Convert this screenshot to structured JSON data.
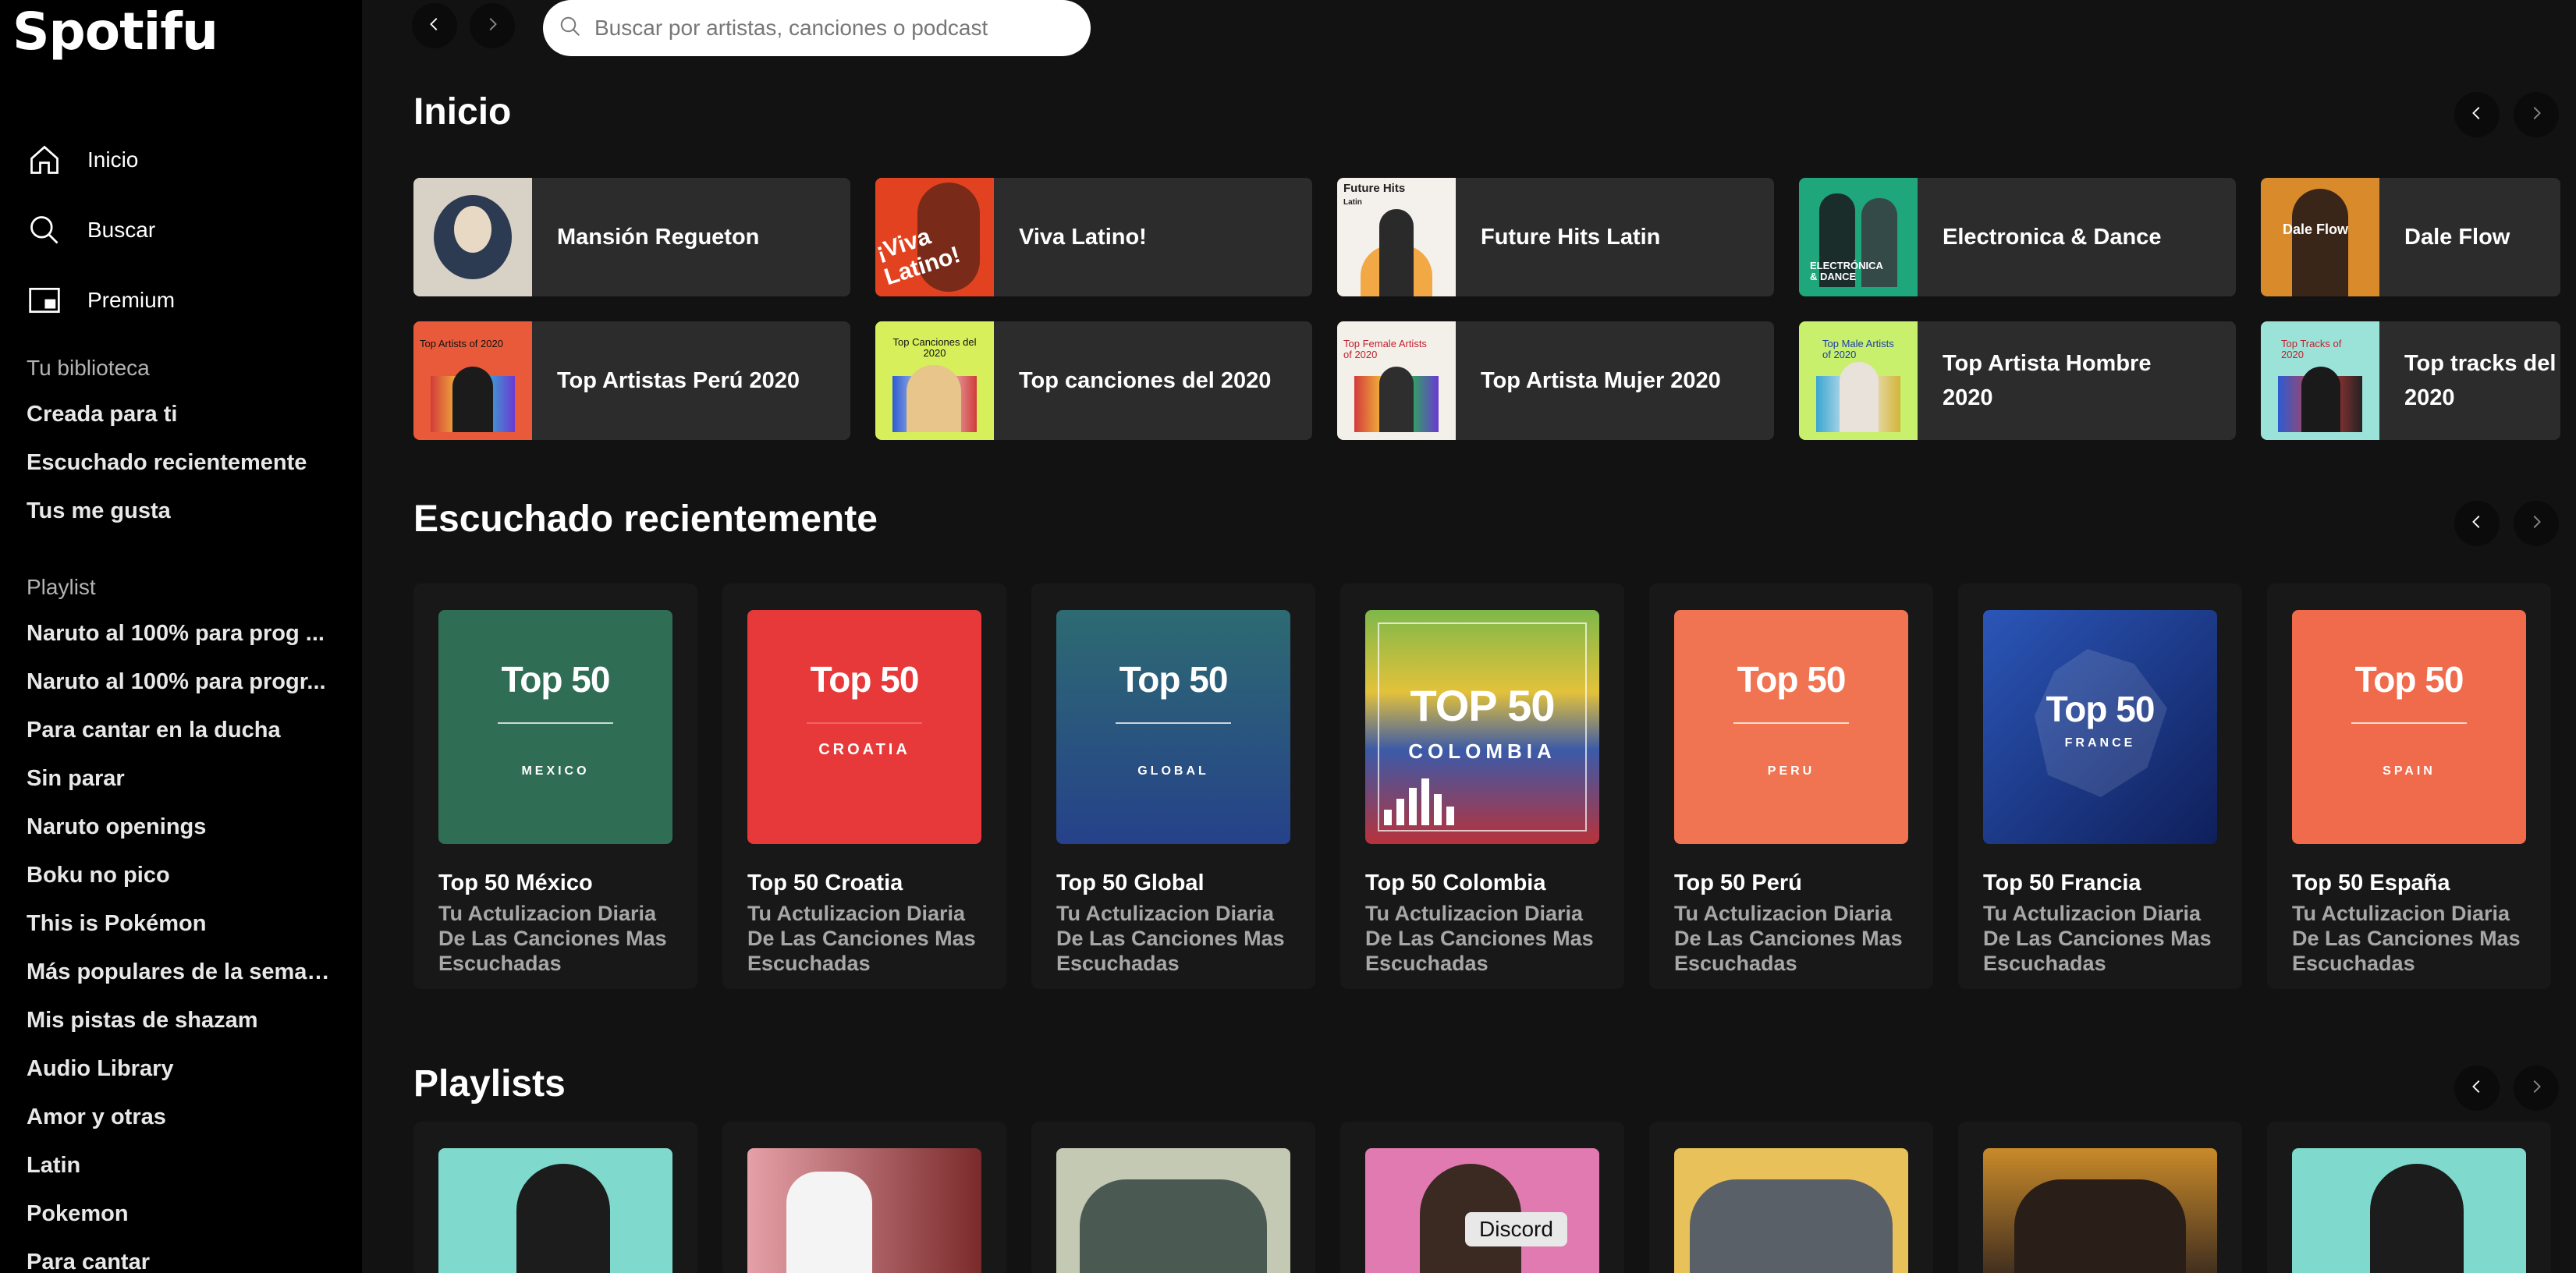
{
  "app": {
    "logo": "Spotifu"
  },
  "sidebar": {
    "nav": [
      {
        "label": "Inicio",
        "icon": "home-icon"
      },
      {
        "label": "Buscar",
        "icon": "search-icon"
      },
      {
        "label": "Premium",
        "icon": "premium-icon"
      }
    ],
    "library_title": "Tu biblioteca",
    "library": [
      "Creada para ti",
      "Escuchado recientemente",
      "Tus me gusta"
    ],
    "playlist_title": "Playlist",
    "playlists": [
      "Naruto al 100% para prog ...",
      "Naruto al 100% para progr...",
      "Para cantar en la ducha",
      "Sin parar",
      "Naruto openings",
      "Boku no pico",
      "This is Pokémon",
      "Más populares de la semana",
      "Mis pistas de shazam",
      "Audio Library",
      "Amor y otras",
      "Latin",
      "Pokemon",
      "Para cantar"
    ]
  },
  "search": {
    "placeholder": "Buscar por artistas, canciones o podcast"
  },
  "sections": {
    "home": "Inicio",
    "recent": "Escuchado recientemente",
    "playlists": "Playlists"
  },
  "home_row1": [
    {
      "label": "Mansión Regueton",
      "color": "#c9c2b8"
    },
    {
      "label": "Viva Latino!",
      "color": "#e2421f"
    },
    {
      "label": "Future Hits Latin",
      "color": "#f1efe9"
    },
    {
      "label": "Electronica & Dance",
      "color": "#1fa77b"
    },
    {
      "label": "Dale Flow",
      "color": "#d98a2a"
    }
  ],
  "home_row2": [
    {
      "label": "Top Artistas Perú 2020",
      "color": "#e85a3a",
      "mini": "Top Artists of 2020"
    },
    {
      "label": "Top canciones del 2020",
      "color": "#d6ef5a",
      "mini": "Top Canciones del 2020"
    },
    {
      "label": "Top Artista Mujer 2020",
      "color": "#f3f0ea",
      "mini": "Top Female Artists of 2020"
    },
    {
      "label": "Top Artista Hombre 2020",
      "color": "#c8f06c",
      "mini": "Top Male Artists of 2020"
    },
    {
      "label": "Top tracks del 2020",
      "color": "#9be3d9",
      "mini": "Top Tracks of 2020"
    }
  ],
  "top50": [
    {
      "title": "Top 50 México",
      "cover": "Top 50",
      "country": "MEXICO",
      "bg": "#2f6e55"
    },
    {
      "title": "Top 50 Croatia",
      "cover": "Top 50",
      "country": "CROATIA",
      "bg": "#e8393a"
    },
    {
      "title": "Top 50 Global",
      "cover": "Top 50",
      "country": "GLOBAL",
      "bg": "#2b4f8a"
    },
    {
      "title": "Top 50 Colombia",
      "cover": "TOP 50",
      "country": "COLOMBIA",
      "bg": "#3b5aa8"
    },
    {
      "title": "Top 50 Perú",
      "cover": "Top 50",
      "country": "PERU",
      "bg": "#f07452"
    },
    {
      "title": "Top 50 Francia",
      "cover": "Top 50",
      "country": "FRANCE",
      "bg": "#1e3f93"
    },
    {
      "title": "Top 50 España",
      "cover": "Top 50",
      "country": "SPAIN",
      "bg": "#f06b4b"
    }
  ],
  "top50_desc": "Tu Actulizacion Diaria De Las Canciones Mas Escuchadas",
  "playlist_covers": [
    "#7fd9cc",
    "#e5a1a8",
    "#6c8f6a",
    "#e07ab0",
    "#e9c15a",
    "#3a2a1e",
    "#7fd9cc"
  ],
  "tooltip": "Discord"
}
